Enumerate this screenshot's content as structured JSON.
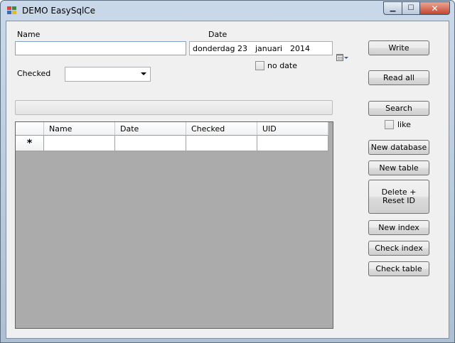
{
  "window": {
    "title": "DEMO EasySqlCe",
    "close_glyph": "✕",
    "min_glyph": "▁",
    "max_glyph": "☐"
  },
  "form": {
    "name_label": "Name",
    "name_value": "",
    "date_label": "Date",
    "date": {
      "weekday_day": "donderdag 23",
      "month": "januari",
      "year": "2014"
    },
    "checked_label": "Checked",
    "checked_value": "",
    "no_date_label": "no date",
    "like_label": "like"
  },
  "buttons": {
    "write": "Write",
    "read_all": "Read all",
    "search": "Search",
    "new_database": "New database",
    "new_table": "New table",
    "delete_reset": "Delete + Reset ID",
    "new_index": "New index",
    "check_index": "Check index",
    "check_table": "Check table"
  },
  "grid": {
    "columns": [
      "Name",
      "Date",
      "Checked",
      "UID"
    ],
    "new_row_marker": "*"
  }
}
